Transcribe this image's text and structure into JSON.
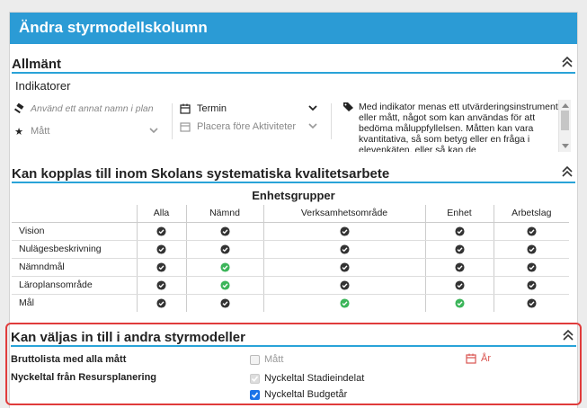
{
  "dialog": {
    "title": "Ändra styrmodellskolumn"
  },
  "general": {
    "heading": "Allmänt",
    "indicator_name": "Indikatorer",
    "alt_name_placeholder": "Använd ett annat namn i plan",
    "type_value": "Mått",
    "period_value": "Termin",
    "placement_placeholder": "Placera före Aktiviteter",
    "description": "Med indikator menas ett utvärderingsinstrument eller mått, något som kan användas för att bedöma måluppfyllelsen. Måtten kan vara kvantitativa, så som betyg eller en fråga i elevenkäten, eller så kan de"
  },
  "connect": {
    "heading": "Kan kopplas till inom Skolans systematiska kvalitetsarbete",
    "group_title": "Enhetsgrupper",
    "columns": [
      "Alla",
      "Nämnd",
      "Verksamhetsområde",
      "Enhet",
      "Arbetslag"
    ],
    "rows": [
      {
        "label": "Vision",
        "checks": [
          "dark",
          "dark",
          "dark",
          "dark",
          "dark"
        ]
      },
      {
        "label": "Nulägesbeskrivning",
        "checks": [
          "dark",
          "dark",
          "dark",
          "dark",
          "dark"
        ]
      },
      {
        "label": "Nämndmål",
        "checks": [
          "dark",
          "green",
          "dark",
          "dark",
          "dark"
        ]
      },
      {
        "label": "Läroplansområde",
        "checks": [
          "dark",
          "green",
          "dark",
          "dark",
          "dark"
        ]
      },
      {
        "label": "Mål",
        "checks": [
          "dark",
          "dark",
          "green",
          "green",
          "dark"
        ]
      }
    ]
  },
  "other": {
    "heading": "Kan väljas in till i andra styrmodeller",
    "row1_label": "Bruttolista med alla mått",
    "row1_option": "Mått",
    "row1_period": "År",
    "row2_label": "Nyckeltal från Resursplanering",
    "row2_opt1": "Nyckeltal Stadieindelat",
    "row2_opt2": "Nyckeltal Budgetår"
  },
  "colors": {
    "accent": "#2b9bd5",
    "check_dark": "#333333",
    "check_green": "#3cb55a",
    "highlight": "#e03b3b"
  }
}
